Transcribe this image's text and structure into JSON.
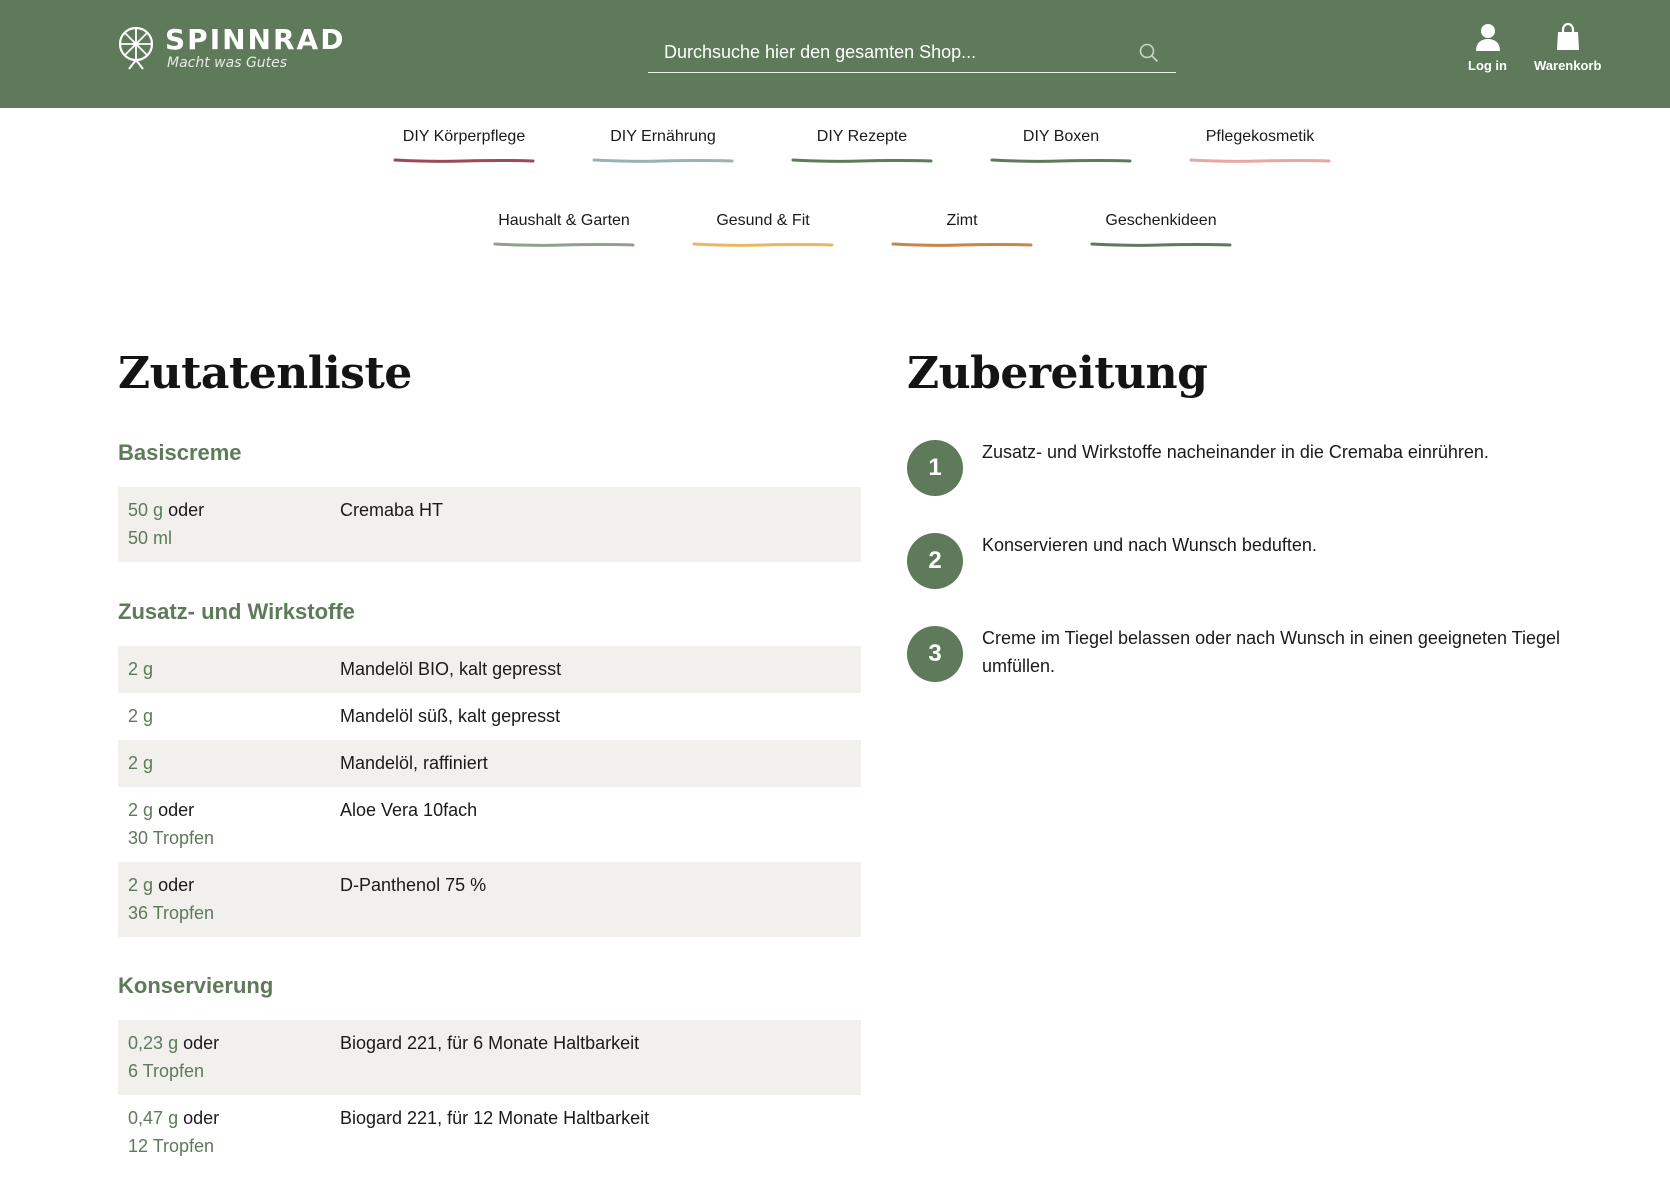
{
  "header": {
    "logo_name": "SPINNRAD",
    "logo_tagline": "Macht was Gutes",
    "search_placeholder": "Durchsuche hier den gesamten Shop...",
    "login_label": "Log in",
    "cart_label": "Warenkorb",
    "bg_color": "#5e7a5a"
  },
  "nav": {
    "row1": [
      {
        "label": "DIY Körperpflege",
        "color": "#9c4a58"
      },
      {
        "label": "DIY Ernährung",
        "color": "#9ab2b2"
      },
      {
        "label": "DIY Rezepte",
        "color": "#5e7a5a"
      },
      {
        "label": "DIY Boxen",
        "color": "#5e7a5a"
      },
      {
        "label": "Pflegekosmetik",
        "color": "#e8a8a0"
      }
    ],
    "row2": [
      {
        "label": "Haushalt & Garten",
        "color": "#8fa08c"
      },
      {
        "label": "Gesund & Fit",
        "color": "#e8b860"
      },
      {
        "label": "Zimt",
        "color": "#c8864a"
      },
      {
        "label": "Geschenkideen",
        "color": "#5e7a5a"
      }
    ]
  },
  "ingredients": {
    "title": "Zutatenliste",
    "groups": [
      {
        "title": "Basiscreme",
        "items": [
          {
            "amount": "50",
            "unit": "g",
            "conj": "oder",
            "alt": "50 ml",
            "name": "Cremaba HT"
          }
        ]
      },
      {
        "title": "Zusatz- und Wirkstoffe",
        "items": [
          {
            "amount": "2",
            "unit": "g",
            "conj": "",
            "alt": "",
            "name": "Mandelöl BIO, kalt gepresst"
          },
          {
            "amount": "2",
            "unit": "g",
            "conj": "",
            "alt": "",
            "name": "Mandelöl süß, kalt gepresst"
          },
          {
            "amount": "2",
            "unit": "g",
            "conj": "",
            "alt": "",
            "name": "Mandelöl, raffiniert"
          },
          {
            "amount": "2",
            "unit": "g",
            "conj": "oder",
            "alt": "30 Tropfen",
            "name": "Aloe Vera 10fach"
          },
          {
            "amount": "2",
            "unit": "g",
            "conj": "oder",
            "alt": "36 Tropfen",
            "name": "D-Panthenol 75 %"
          }
        ]
      },
      {
        "title": "Konservierung",
        "items": [
          {
            "amount": "0,23",
            "unit": "g",
            "conj": "oder",
            "alt": "6 Tropfen",
            "name": "Biogard 221, für 6 Monate Haltbarkeit"
          },
          {
            "amount": "0,47",
            "unit": "g",
            "conj": "oder",
            "alt": "12 Tropfen",
            "name": "Biogard 221, für 12 Monate Haltbarkeit"
          }
        ]
      }
    ]
  },
  "preparation": {
    "title": "Zubereitung",
    "steps": [
      {
        "num": "1",
        "text": "Zusatz- und Wirkstoffe nacheinander in die Cremaba einrühren."
      },
      {
        "num": "2",
        "text": "Konservieren und nach Wunsch beduften."
      },
      {
        "num": "3",
        "text": "Creme im Tiegel belassen oder nach Wunsch in einen geeigneten Tiegel umfüllen."
      }
    ]
  }
}
